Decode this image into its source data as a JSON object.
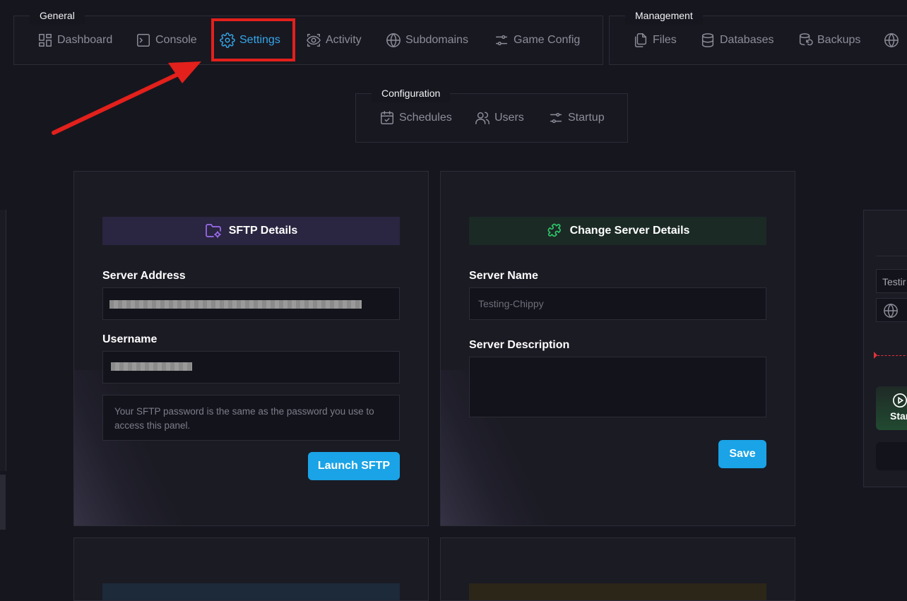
{
  "nav": {
    "general": {
      "label": "General",
      "items": [
        {
          "label": "Dashboard",
          "icon": "dashboard-icon"
        },
        {
          "label": "Console",
          "icon": "console-icon"
        },
        {
          "label": "Settings",
          "icon": "gear-icon",
          "active": true
        },
        {
          "label": "Activity",
          "icon": "activity-icon"
        },
        {
          "label": "Subdomains",
          "icon": "globe-icon"
        },
        {
          "label": "Game Config",
          "icon": "sliders-icon"
        }
      ]
    },
    "management": {
      "label": "Management",
      "items": [
        {
          "label": "Files",
          "icon": "files-icon"
        },
        {
          "label": "Databases",
          "icon": "database-icon"
        },
        {
          "label": "Backups",
          "icon": "backup-icon"
        }
      ]
    },
    "configuration": {
      "label": "Configuration",
      "items": [
        {
          "label": "Schedules",
          "icon": "calendar-icon"
        },
        {
          "label": "Users",
          "icon": "users-icon"
        },
        {
          "label": "Startup",
          "icon": "sliders-icon"
        }
      ]
    }
  },
  "sftp": {
    "title": "SFTP Details",
    "server_address_label": "Server Address",
    "username_label": "Username",
    "note": "Your SFTP password is the same as the password you use to access this panel.",
    "launch_label": "Launch SFTP"
  },
  "server_details": {
    "title": "Change Server Details",
    "name_label": "Server Name",
    "name_value": "Testing-Chippy",
    "description_label": "Server Description",
    "description_value": "",
    "save_label": "Save"
  },
  "side_panel": {
    "name_fragment": "Testir",
    "start_fragment": "Star"
  },
  "colors": {
    "accent": "#36a7e9",
    "button": "#1aa3e6",
    "annotation": "#e3201b",
    "sftp_header": "#2a2540",
    "server_header": "#1b2a24"
  }
}
